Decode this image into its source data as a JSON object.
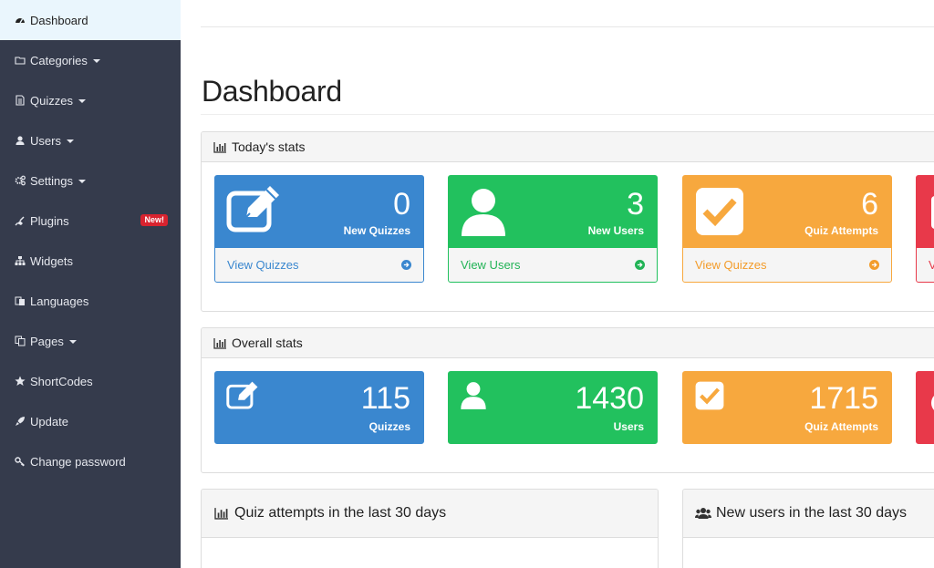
{
  "sidebar": {
    "items": [
      {
        "label": "Dashboard",
        "icon": "dashboard-icon",
        "active": true
      },
      {
        "label": "Categories",
        "icon": "folder-icon",
        "caret": true
      },
      {
        "label": "Quizzes",
        "icon": "file-icon",
        "caret": true
      },
      {
        "label": "Users",
        "icon": "user-icon",
        "caret": true
      },
      {
        "label": "Settings",
        "icon": "gears-icon",
        "caret": true
      },
      {
        "label": "Plugins",
        "icon": "plug-icon",
        "badge": "New!"
      },
      {
        "label": "Widgets",
        "icon": "sitemap-icon"
      },
      {
        "label": "Languages",
        "icon": "language-icon"
      },
      {
        "label": "Pages",
        "icon": "copy-icon",
        "caret": true
      },
      {
        "label": "ShortCodes",
        "icon": "star-icon"
      },
      {
        "label": "Update",
        "icon": "rocket-icon"
      },
      {
        "label": "Change password",
        "icon": "key-icon"
      }
    ]
  },
  "main": {
    "title": "Dashboard",
    "today": {
      "heading": "Today's stats",
      "boxes": [
        {
          "value": "0",
          "label": "New Quizzes",
          "link": "View Quizzes",
          "color": "#3a87cf",
          "icon": "edit-icon"
        },
        {
          "value": "3",
          "label": "New Users",
          "link": "View Users",
          "color": "#22c15e",
          "icon": "user-icon"
        },
        {
          "value": "6",
          "label": "Quiz Attempts",
          "link": "View Quizzes",
          "color": "#f7a83e",
          "icon": "check-square-icon"
        },
        {
          "value": "",
          "label": "",
          "link": "V",
          "color": "#e8394a",
          "icon": "cut-off-icon"
        }
      ]
    },
    "overall": {
      "heading": "Overall stats",
      "boxes": [
        {
          "value": "115",
          "label": "Quizzes",
          "color": "#3a87cf",
          "icon": "edit-icon"
        },
        {
          "value": "1430",
          "label": "Users",
          "color": "#22c15e",
          "icon": "user-icon"
        },
        {
          "value": "1715",
          "label": "Quiz Attempts",
          "color": "#f7a83e",
          "icon": "check-square-icon"
        },
        {
          "value": "",
          "label": "",
          "color": "#e8394a",
          "icon": "cut-off-icon"
        }
      ]
    },
    "charts": [
      {
        "heading": "Quiz attempts in the last 30 days",
        "icon": "bar-chart-icon"
      },
      {
        "heading": "New users in the last 30 days",
        "icon": "users-icon"
      }
    ]
  },
  "colors": {
    "sidebar_bg": "#353b4c",
    "active_bg": "#eaf6fd",
    "blue": "#3a87cf",
    "green": "#22c15e",
    "orange": "#f7a83e",
    "red": "#e8394a"
  }
}
